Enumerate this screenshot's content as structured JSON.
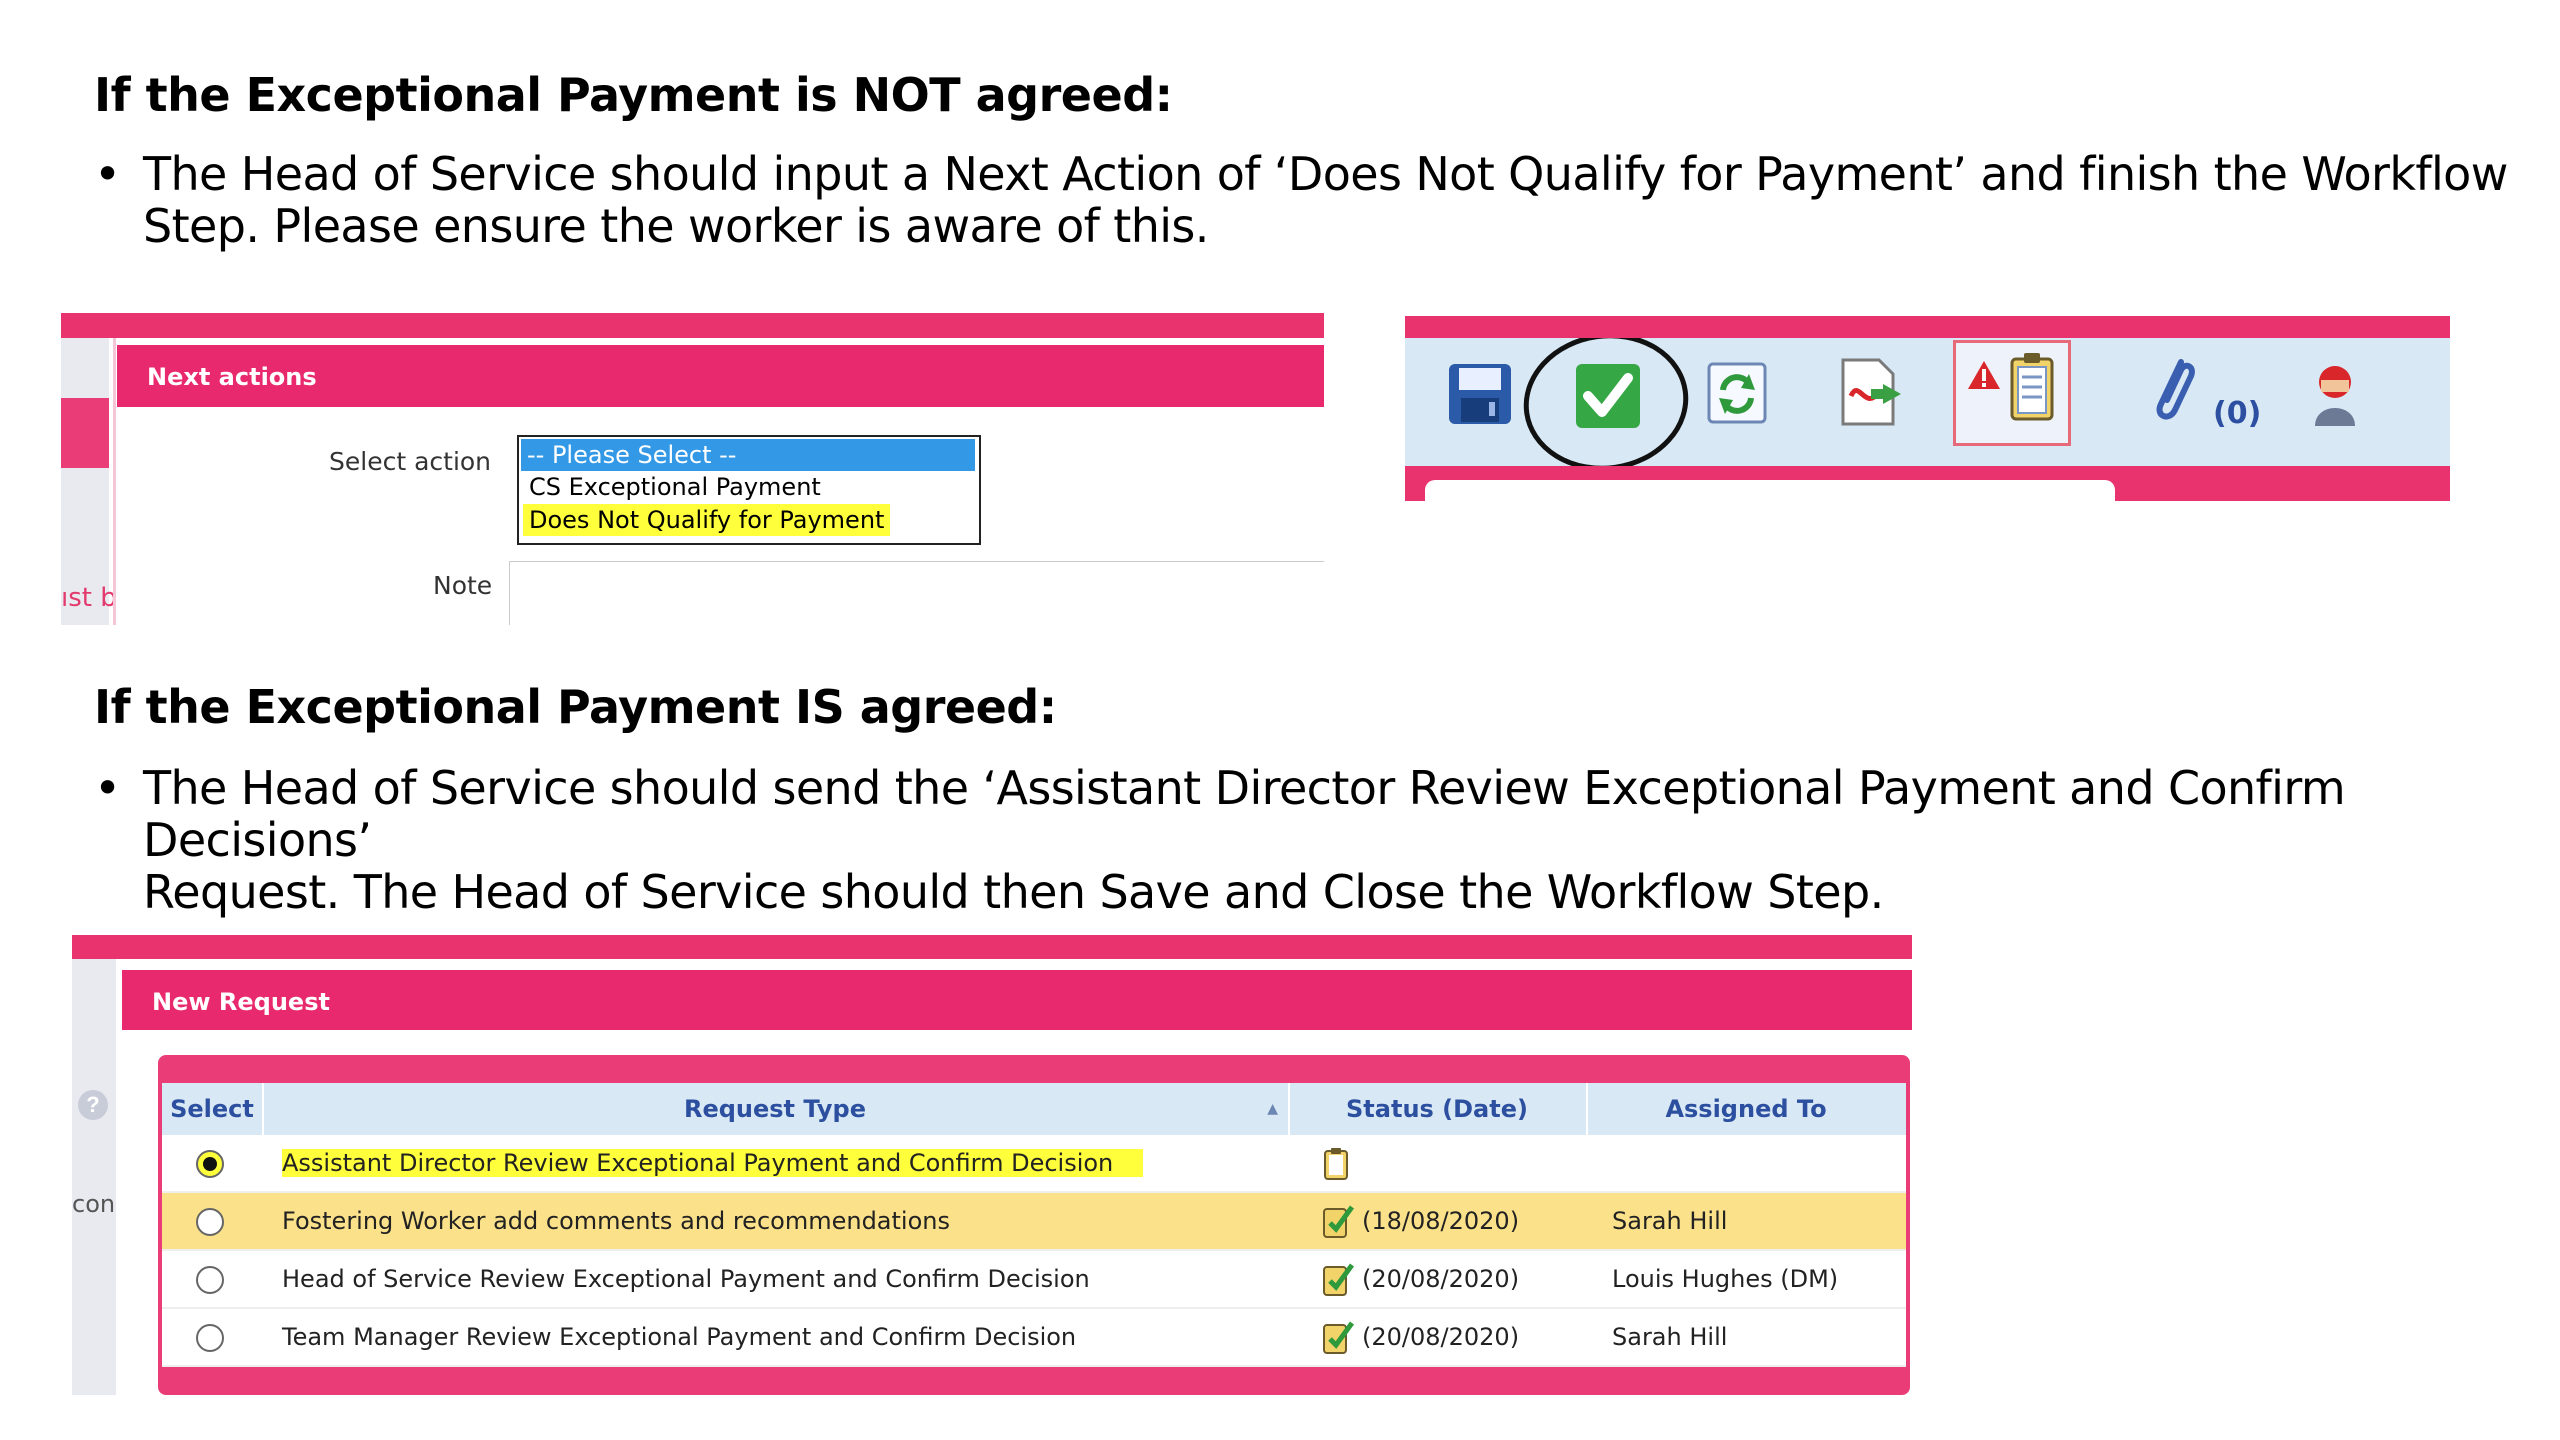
{
  "section1": {
    "heading": "If the Exceptional Payment is NOT agreed:",
    "bullet": "•",
    "line1": "The Head of Service should input a Next Action of ‘Does Not Qualify for Payment’ and finish the Workflow",
    "line2": "Step. Please ensure the worker is aware of this."
  },
  "next_actions": {
    "header": "Next actions",
    "left_cut_text": "ıst b",
    "select_label": "Select action",
    "options": [
      "-- Please Select --",
      "CS Exceptional Payment",
      "Does Not Qualify for Payment"
    ],
    "note_label": "Note"
  },
  "toolbar": {
    "icons": [
      "save-icon",
      "finish-check-icon",
      "refresh-icon",
      "pdf-export-icon",
      "alert-clipboard-icon",
      "attachment-icon",
      "user-icon"
    ],
    "attachment_count": "(0)"
  },
  "section2": {
    "heading": "If the Exceptional Payment IS agreed:",
    "bullet": "•",
    "line1": "The Head of Service should send the ‘Assistant Director Review Exceptional Payment and Confirm Decisions’",
    "line2": "Request. The Head of Service should then Save and Close the Workflow Step."
  },
  "new_request": {
    "header": "New Request",
    "left_cut_text": "con",
    "help_glyph": "?",
    "columns": [
      "Select",
      "Request Type",
      "Status (Date)",
      "Assigned To"
    ],
    "sort_glyph": "▲",
    "rows": [
      {
        "type": "Assistant Director Review Exceptional Payment and Confirm Decision",
        "date": "",
        "assigned": ""
      },
      {
        "type": "Fostering Worker add comments and recommendations",
        "date": "(18/08/2020)",
        "assigned": "Sarah Hill"
      },
      {
        "type": "Head of Service Review Exceptional Payment and Confirm Decision",
        "date": "(20/08/2020)",
        "assigned": "Louis Hughes (DM)"
      },
      {
        "type": "Team Manager Review Exceptional Payment and Confirm Decision",
        "date": "(20/08/2020)",
        "assigned": "Sarah Hill"
      }
    ]
  },
  "colors": {
    "brand_pink": "#e9296d",
    "header_blue": "#d8e8f4",
    "highlight_yellow": "#ffff3b",
    "row_yellow": "#fbe28a"
  }
}
